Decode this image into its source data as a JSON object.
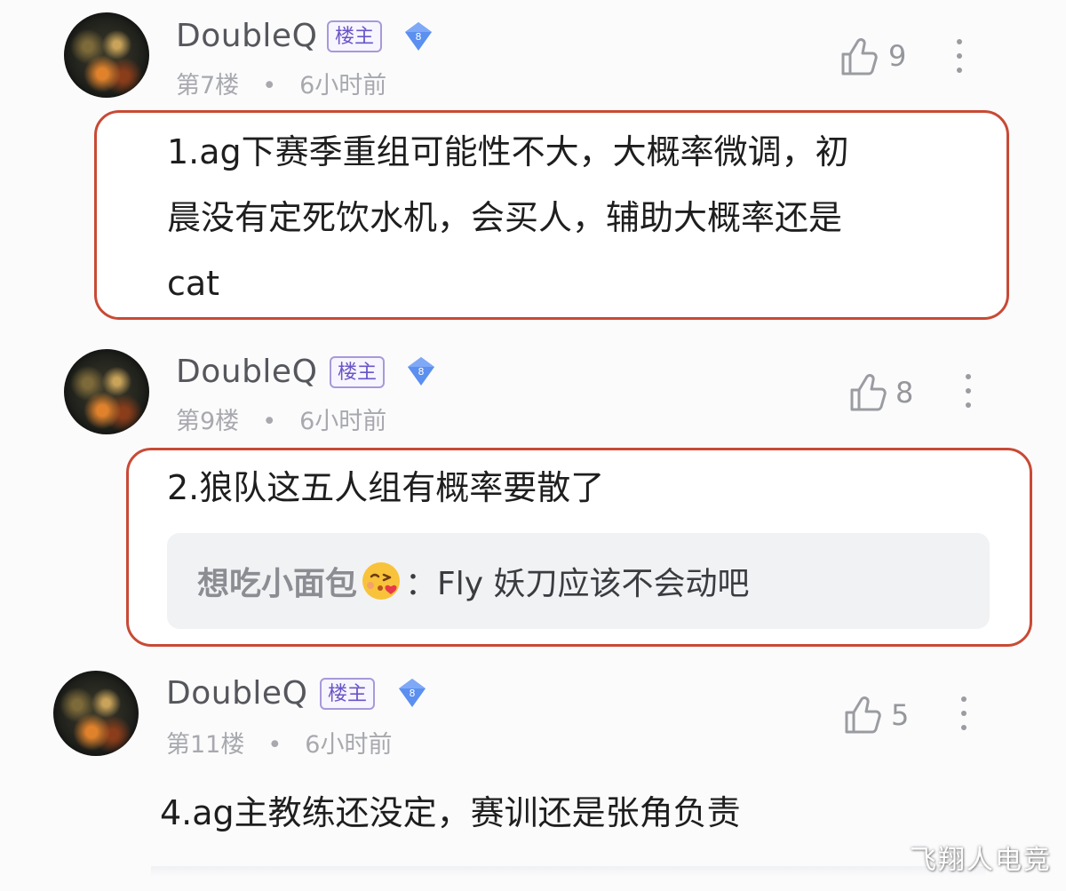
{
  "posts": [
    {
      "username": "DoubleQ",
      "badge": "楼主",
      "level": "8",
      "floor": "第7楼",
      "separator": "•",
      "time": "6小时前",
      "likes": "9",
      "body_lines": [
        "1.ag下赛季重组可能性不大，大概率微调，初",
        "晨没有定死饮水机，会买人，辅助大概率还是",
        "cat"
      ]
    },
    {
      "username": "DoubleQ",
      "badge": "楼主",
      "level": "8",
      "floor": "第9楼",
      "separator": "•",
      "time": "6小时前",
      "likes": "8",
      "body_lines": [
        "2.狼队这五人组有概率要散了"
      ],
      "reply": {
        "author": "想吃小面包",
        "emoji": "kissing-face-emoji",
        "separator": "：",
        "text": "Fly 妖刀应该不会动吧"
      }
    },
    {
      "username": "DoubleQ",
      "badge": "楼主",
      "level": "8",
      "floor": "第11楼",
      "separator": "•",
      "time": "6小时前",
      "likes": "5",
      "body_lines": [
        "4.ag主教练还没定，赛训还是张角负责"
      ]
    }
  ],
  "watermark": "飞翔人电竞",
  "colors": {
    "highlight_border": "#c84a35",
    "badge_border": "#a899d8",
    "badge_text": "#6a55c7",
    "level_icon": "#5b8ff0",
    "meta_text": "#a7a9ae"
  }
}
